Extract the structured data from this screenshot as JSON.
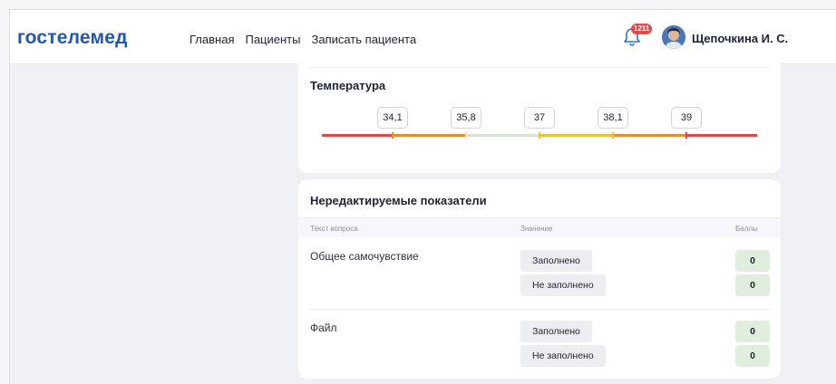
{
  "header": {
    "logo": "гостелемед",
    "nav": [
      "Главная",
      "Пациенты",
      "Записать пациента"
    ],
    "notifications_count": "1211",
    "user_name": "Щепочкина И. С."
  },
  "temperature": {
    "title": "Температура",
    "thresholds": [
      "34,1",
      "35,8",
      "37",
      "38,1",
      "39"
    ],
    "scale_colors": [
      "#e04848",
      "#e88a2e",
      "#d6e4d2",
      "#ecc23a",
      "#e88a2e",
      "#e04848"
    ]
  },
  "non_editable": {
    "title": "Нередактируемые показатели",
    "columns": {
      "question": "Текст вопроса",
      "value": "Значение",
      "score": "Баллы"
    },
    "rows": [
      {
        "label": "Общее самочувствие",
        "options": [
          "Заполнено",
          "Не заполнено"
        ],
        "scores": [
          "0",
          "0"
        ]
      },
      {
        "label": "Файл",
        "options": [
          "Заполнено",
          "Не заполнено"
        ],
        "scores": [
          "0",
          "0"
        ]
      }
    ]
  }
}
